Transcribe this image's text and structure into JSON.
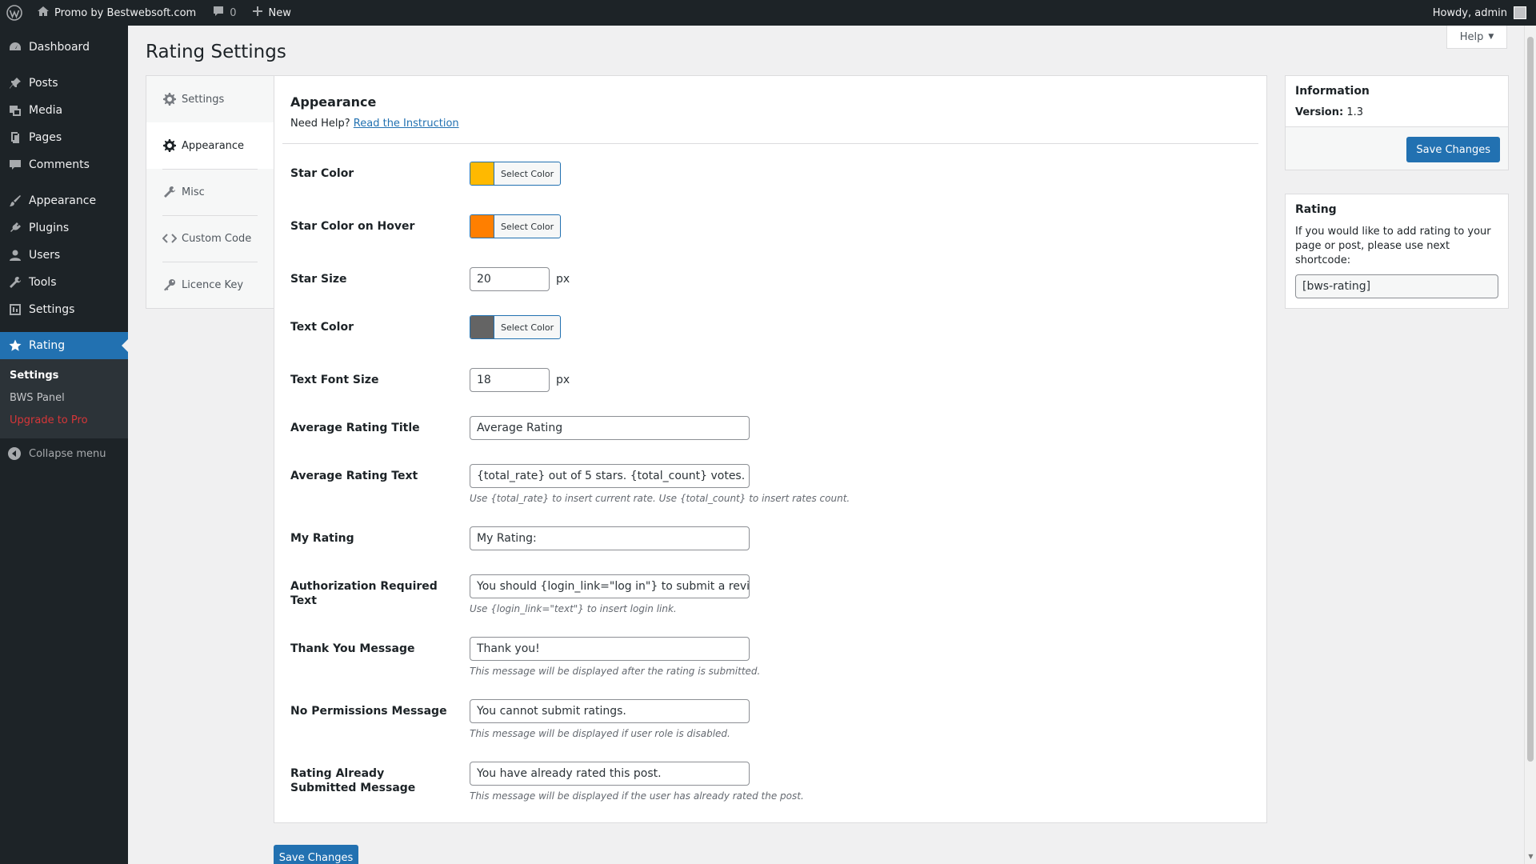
{
  "adminbar": {
    "site_name": "Promo by Bestwebsoft.com",
    "comments_count": "0",
    "new_label": "New",
    "howdy": "Howdy, admin"
  },
  "sidebar": {
    "items": [
      {
        "label": "Dashboard",
        "icon": "dashboard-icon"
      },
      {
        "label": "Posts",
        "icon": "pin-icon"
      },
      {
        "label": "Media",
        "icon": "media-icon"
      },
      {
        "label": "Pages",
        "icon": "pages-icon"
      },
      {
        "label": "Comments",
        "icon": "comment-icon"
      },
      {
        "label": "Appearance",
        "icon": "brush-icon"
      },
      {
        "label": "Plugins",
        "icon": "plug-icon"
      },
      {
        "label": "Users",
        "icon": "user-icon"
      },
      {
        "label": "Tools",
        "icon": "wrench-icon"
      },
      {
        "label": "Settings",
        "icon": "settings-icon"
      },
      {
        "label": "Rating",
        "icon": "star-icon"
      }
    ],
    "submenu": [
      "Settings",
      "BWS Panel",
      "Upgrade to Pro"
    ],
    "collapse": "Collapse menu"
  },
  "page": {
    "title": "Rating Settings",
    "help": "Help"
  },
  "tabs": [
    "Settings",
    "Appearance",
    "Misc",
    "Custom Code",
    "Licence Key"
  ],
  "panel": {
    "heading": "Appearance",
    "need_help": "Need Help?",
    "instruction_link": "Read the Instruction",
    "select_color": "Select Color",
    "px": "px",
    "fields": {
      "star_color": {
        "label": "Star Color",
        "color": "#ffb900"
      },
      "star_hover": {
        "label": "Star Color on Hover",
        "color": "#ff7f00"
      },
      "star_size": {
        "label": "Star Size",
        "value": "20"
      },
      "text_color": {
        "label": "Text Color",
        "color": "#646464"
      },
      "font_size": {
        "label": "Text Font Size",
        "value": "18"
      },
      "avg_title": {
        "label": "Average Rating Title",
        "value": "Average Rating"
      },
      "avg_text": {
        "label": "Average Rating Text",
        "value": "{total_rate} out of 5 stars. {total_count} votes.",
        "desc": "Use {total_rate} to insert current rate. Use {total_count} to insert rates count."
      },
      "my_rating": {
        "label": "My Rating",
        "value": "My Rating:"
      },
      "auth_text": {
        "label": "Authorization Required Text",
        "value": "You should {login_link=\"log in\"} to submit a review.",
        "desc": "Use {login_link=\"text\"} to insert login link."
      },
      "thank_you": {
        "label": "Thank You Message",
        "value": "Thank you!",
        "desc": "This message will be displayed after the rating is submitted."
      },
      "no_perm": {
        "label": "No Permissions Message",
        "value": "You cannot submit ratings.",
        "desc": "This message will be displayed if user role is disabled."
      },
      "already": {
        "label": "Rating Already Submitted Message",
        "value": "You have already rated this post.",
        "desc": "This message will be displayed if the user has already rated the post."
      }
    },
    "save": "Save Changes"
  },
  "info_box": {
    "title": "Information",
    "version_label": "Version:",
    "version_value": "1.3",
    "save": "Save Changes"
  },
  "rating_box": {
    "title": "Rating",
    "text": "If you would like to add rating to your page or post, please use next shortcode:",
    "shortcode": "[bws-rating]"
  }
}
